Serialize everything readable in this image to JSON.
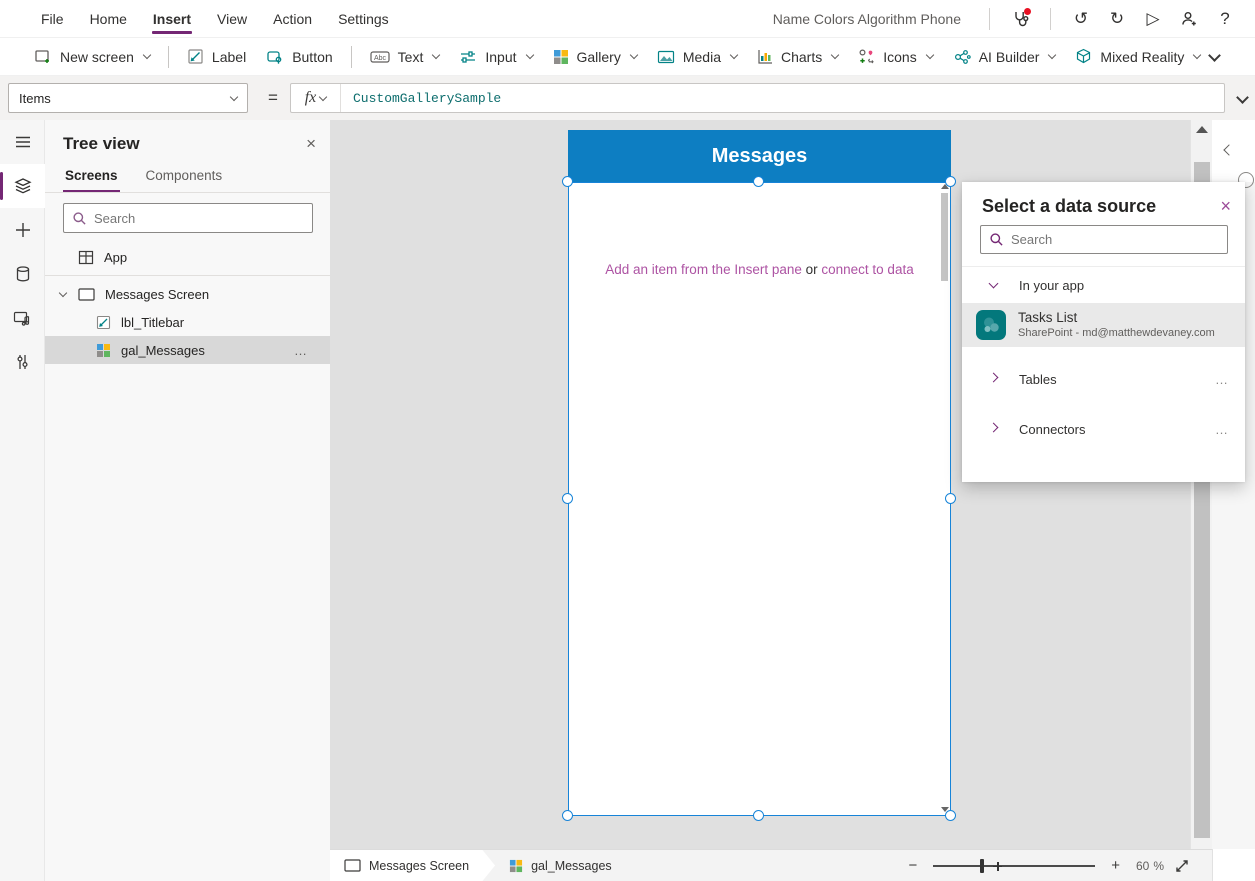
{
  "colors": {
    "accent_purple": "#742774",
    "titlebar_blue": "#0d7ec2",
    "selection_blue": "#1784d8",
    "ribbon_teal": "#038387",
    "formula_teal": "#0e6e6e",
    "empty_text_magenta": "#ad53a3"
  },
  "icons": {
    "close": "×",
    "ellipsis": "…",
    "help": "?",
    "undo": "↺",
    "redo": "↻",
    "play": "▷",
    "minus": "−",
    "plus": "+"
  },
  "menu_bar": {
    "items": [
      "File",
      "Home",
      "Insert",
      "View",
      "Action",
      "Settings"
    ],
    "active_item": "Insert",
    "app_title": "Name Colors Algorithm Phone"
  },
  "ribbon": {
    "items": [
      {
        "label": "New screen",
        "dropdown": true
      },
      {
        "label": "Label",
        "dropdown": false
      },
      {
        "label": "Button",
        "dropdown": false
      },
      {
        "label": "Text",
        "dropdown": true
      },
      {
        "label": "Input",
        "dropdown": true
      },
      {
        "label": "Gallery",
        "dropdown": true
      },
      {
        "label": "Media",
        "dropdown": true
      },
      {
        "label": "Charts",
        "dropdown": true
      },
      {
        "label": "Icons",
        "dropdown": true
      },
      {
        "label": "AI Builder",
        "dropdown": true
      },
      {
        "label": "Mixed Reality",
        "dropdown": true
      }
    ]
  },
  "formula_bar": {
    "property_selector": "Items",
    "equals": "=",
    "fx_label": "fx",
    "formula": "CustomGallerySample"
  },
  "tree_view": {
    "title": "Tree view",
    "tabs": [
      {
        "label": "Screens",
        "active": true
      },
      {
        "label": "Components",
        "active": false
      }
    ],
    "search_placeholder": "Search",
    "app_item": "App",
    "screen_name": "Messages Screen",
    "children": [
      {
        "name": "lbl_Titlebar"
      },
      {
        "name": "gal_Messages"
      }
    ]
  },
  "canvas": {
    "screen_title": "Messages",
    "empty_text_prefix": "Add an item from the Insert pane ",
    "empty_text_or": "or",
    "empty_text_link": " connect to data"
  },
  "data_source_panel": {
    "title": "Select a data source",
    "search_placeholder": "Search",
    "in_your_app_label": "In your app",
    "item": {
      "title": "Tasks List",
      "subtitle": "SharePoint - md@matthewdevaney.com"
    },
    "tables_label": "Tables",
    "connectors_label": "Connectors"
  },
  "status_bar": {
    "screen_crumb": "Messages Screen",
    "control_crumb": "gal_Messages",
    "zoom_value": "60",
    "zoom_unit": "%"
  }
}
